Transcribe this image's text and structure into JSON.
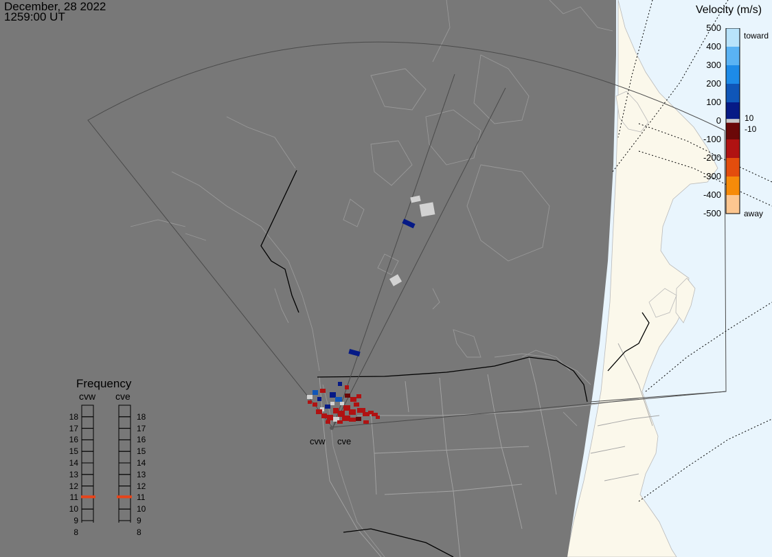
{
  "header": {
    "date": "December, 28 2022",
    "time": "1259:00 UT"
  },
  "colors": {
    "night": "#787878",
    "day_ocean": "#e9f5fd",
    "day_land": "#fbf8eb",
    "fov_line": "#4a4a4a",
    "gray_scatter": "#d2d2d2",
    "frequency_marker": "#e8441a"
  },
  "velocity_scale": {
    "title": "Velocity (m/s)",
    "ticks": [
      "500",
      "400",
      "300",
      "200",
      "100",
      "0",
      "-100",
      "-200",
      "-300",
      "-400",
      "-500"
    ],
    "upper_label": "toward",
    "lower_label": "away",
    "near_zero_upper": "10",
    "near_zero_lower": "-10",
    "color_stops": [
      {
        "from": 500,
        "to": 400,
        "color": "#b8e3fb"
      },
      {
        "from": 400,
        "to": 300,
        "color": "#5ab3f4"
      },
      {
        "from": 300,
        "to": 200,
        "color": "#1d8be8"
      },
      {
        "from": 200,
        "to": 100,
        "color": "#0f56b8"
      },
      {
        "from": 100,
        "to": 10,
        "color": "#061a86"
      },
      {
        "from": 10,
        "to": -10,
        "color": "#c8c8c8"
      },
      {
        "from": -10,
        "to": -100,
        "color": "#6b0808"
      },
      {
        "from": -100,
        "to": -200,
        "color": "#b01212"
      },
      {
        "from": -200,
        "to": -300,
        "color": "#e34d0d"
      },
      {
        "from": -300,
        "to": -400,
        "color": "#f68b0a"
      },
      {
        "from": -400,
        "to": -500,
        "color": "#fcc690"
      }
    ]
  },
  "frequency": {
    "title": "Frequency",
    "radars": [
      {
        "code": "cvw",
        "selected": 11
      },
      {
        "code": "cve",
        "selected": 11
      }
    ],
    "levels": [
      "18",
      "17",
      "16",
      "15",
      "14",
      "13",
      "12",
      "11",
      "10",
      "9",
      "8"
    ]
  },
  "radar_sites": [
    {
      "code": "cvw"
    },
    {
      "code": "cve"
    }
  ]
}
